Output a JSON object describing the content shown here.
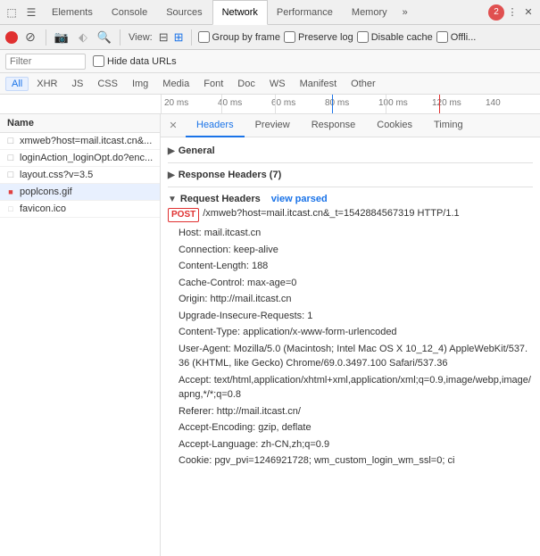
{
  "tabs": {
    "items": [
      {
        "label": "Elements",
        "active": false
      },
      {
        "label": "Console",
        "active": false
      },
      {
        "label": "Sources",
        "active": false
      },
      {
        "label": "Network",
        "active": true
      },
      {
        "label": "Performance",
        "active": false
      },
      {
        "label": "Memory",
        "active": false
      }
    ],
    "more_label": "»",
    "error_count": "2"
  },
  "toolbar": {
    "view_label": "View:",
    "group_by_frame_label": "Group by frame",
    "preserve_log_label": "Preserve log",
    "disable_cache_label": "Disable cache",
    "offline_label": "Offli..."
  },
  "filter": {
    "placeholder": "Filter",
    "hide_data_label": "Hide data URLs"
  },
  "type_filters": {
    "items": [
      {
        "label": "All",
        "active": true
      },
      {
        "label": "XHR",
        "active": false
      },
      {
        "label": "JS",
        "active": false
      },
      {
        "label": "CSS",
        "active": false
      },
      {
        "label": "Img",
        "active": false
      },
      {
        "label": "Media",
        "active": false
      },
      {
        "label": "Font",
        "active": false
      },
      {
        "label": "Doc",
        "active": false
      },
      {
        "label": "WS",
        "active": false
      },
      {
        "label": "Manifest",
        "active": false
      },
      {
        "label": "Other",
        "active": false
      }
    ]
  },
  "timeline": {
    "ticks": [
      "20 ms",
      "40 ms",
      "60 ms",
      "80 ms",
      "100 ms",
      "120 ms",
      "140"
    ]
  },
  "file_list": {
    "header": "Name",
    "items": [
      {
        "name": "xmweb?host=mail.itcast.cn&...",
        "type": "page",
        "selected": false
      },
      {
        "name": "loginAction_loginOpt.do?enc...",
        "type": "page",
        "selected": false
      },
      {
        "name": "layout.css?v=3.5",
        "type": "page",
        "selected": false
      },
      {
        "name": "poplcons.gif",
        "type": "gif",
        "selected": true
      },
      {
        "name": "favicon.ico",
        "type": "ico",
        "selected": false
      }
    ]
  },
  "right_panel": {
    "tabs": [
      {
        "label": "Headers",
        "active": true
      },
      {
        "label": "Preview",
        "active": false
      },
      {
        "label": "Response",
        "active": false
      },
      {
        "label": "Cookies",
        "active": false
      },
      {
        "label": "Timing",
        "active": false
      }
    ],
    "sections": {
      "general": {
        "label": "General"
      },
      "response_headers": {
        "label": "Response Headers (7)"
      },
      "request_headers": {
        "label": "Request Headers",
        "view_parsed": "view parsed",
        "method_badge": "POST",
        "url_value": "/xmweb?host=mail.itcast.cn&_t=1542884567319 HTTP/1.1",
        "lines": [
          "Host: mail.itcast.cn",
          "Connection: keep-alive",
          "Content-Length: 188",
          "Cache-Control: max-age=0",
          "Origin: http://mail.itcast.cn",
          "Upgrade-Insecure-Requests: 1",
          "Content-Type: application/x-www-form-urlencoded",
          "User-Agent: Mozilla/5.0 (Macintosh; Intel Mac OS X 10_12_4) AppleWebKit/537.36 (KHTML, like Gecko) Chrome/69.0.3497.100 Safari/537.36",
          "Accept: text/html,application/xhtml+xml,application/xml;q=0.9,image/webp,image/apng,*/*;q=0.8",
          "Referer: http://mail.itcast.cn/",
          "Accept-Encoding: gzip, deflate",
          "Accept-Language: zh-CN,zh;q=0.9",
          "Cookie: pgv_pvi=1246921728; wm_custom_login_wm_ssl=0; ci"
        ]
      }
    }
  }
}
